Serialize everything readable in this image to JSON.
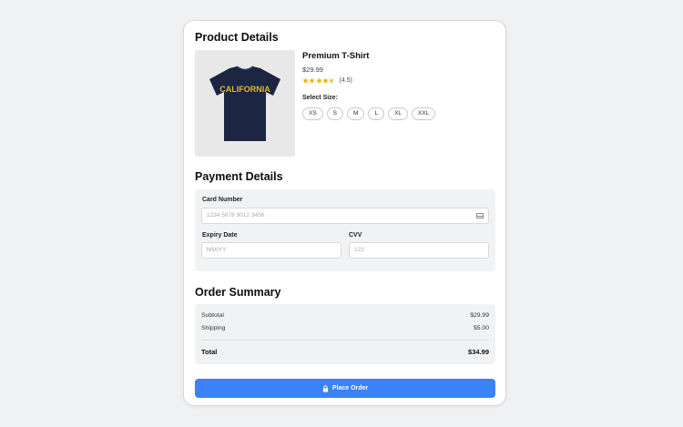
{
  "product_section": {
    "title": "Product Details",
    "product": {
      "name": "Premium T-Shirt",
      "price": "$29.99",
      "rating_text": "(4.5)",
      "rating_value": 4.5,
      "shirt_text": "CALIFORNIA",
      "image_icon": "tshirt-image"
    },
    "size_label": "Select Size:",
    "sizes": [
      "XS",
      "S",
      "M",
      "L",
      "XL",
      "XXL"
    ]
  },
  "payment_section": {
    "title": "Payment Details",
    "card_number": {
      "label": "Card Number",
      "placeholder": "1234 5678 9012 3456",
      "value": "",
      "icon": "credit-card-icon"
    },
    "expiry": {
      "label": "Expiry Date",
      "placeholder": "MM/YY",
      "value": ""
    },
    "cvv": {
      "label": "CVV",
      "placeholder": "123",
      "value": ""
    }
  },
  "summary_section": {
    "title": "Order Summary",
    "subtotal_label": "Subtotal",
    "subtotal_value": "$29.99",
    "shipping_label": "Shipping",
    "shipping_value": "$5.00",
    "total_label": "Total",
    "total_value": "$34.99"
  },
  "actions": {
    "place_order_label": "Place Order",
    "place_order_icon": "lock-icon"
  },
  "colors": {
    "accent": "#3b82f6",
    "star": "#f5b301",
    "shirt": "#1c2541",
    "shirt_text": "#e8b923"
  }
}
